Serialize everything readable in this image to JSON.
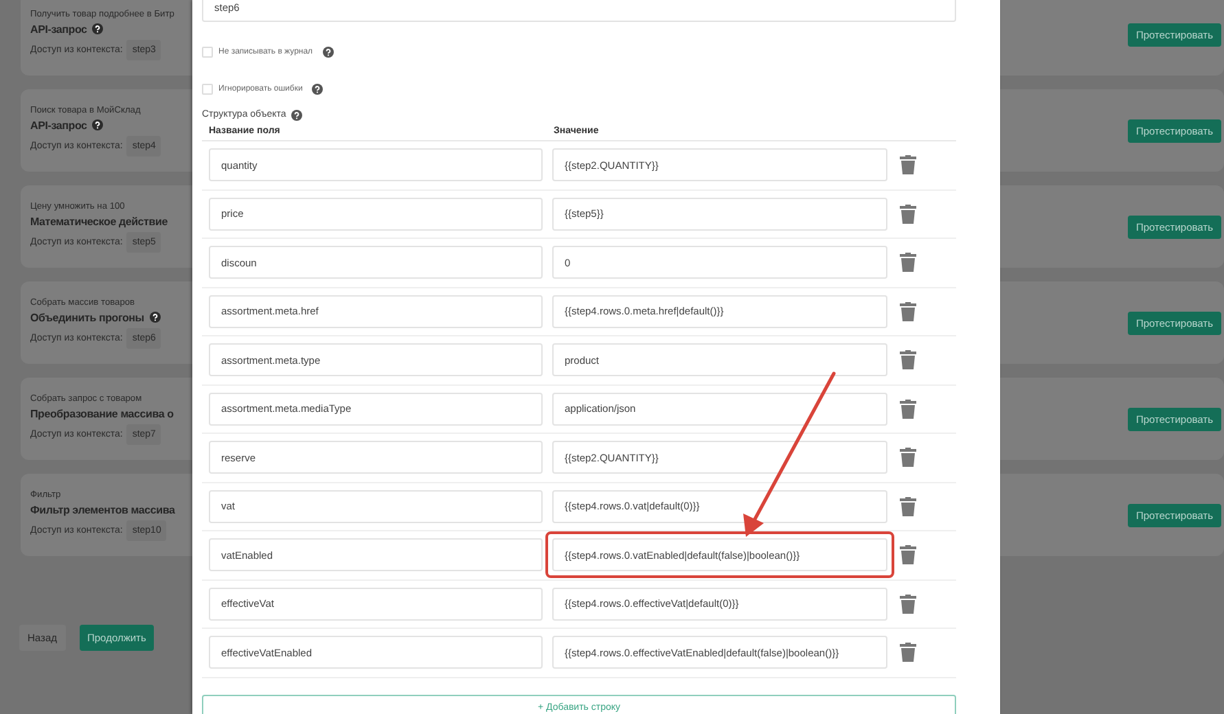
{
  "background_steps": [
    {
      "subtitle": "Получить товар подробнее в Битр",
      "title": "API-запрос",
      "help": true,
      "context_label": "Доступ из контекста:",
      "context_value": "step3",
      "button": "Протестировать"
    },
    {
      "subtitle": "Поиск товара в МойСклад",
      "title": "API-запрос",
      "help": true,
      "context_label": "Доступ из контекста:",
      "context_value": "step4",
      "button": "Протестировать"
    },
    {
      "subtitle": "Цену умножить на 100",
      "title": "Математическое действие",
      "help": false,
      "context_label": "Доступ из контекста:",
      "context_value": "step5",
      "button": "Протестировать"
    },
    {
      "subtitle": "Собрать массив товаров",
      "title": "Объединить прогоны",
      "help": true,
      "context_label": "Доступ из контекста:",
      "context_value": "step6",
      "button": "Протестировать"
    },
    {
      "subtitle": "Собрать запрос с товаром",
      "title": "Преобразование массива о",
      "help": false,
      "context_label": "Доступ из контекста:",
      "context_value": "step7",
      "button": "Протестировать"
    },
    {
      "subtitle": "Фильтр",
      "title": "Фильтр элементов массива",
      "help": false,
      "context_label": "Доступ из контекста:",
      "context_value": "step10",
      "button": "Протестировать"
    }
  ],
  "footer_buttons": [
    {
      "label": "Назад",
      "kind": "secondary"
    },
    {
      "label": "Продолжить",
      "kind": "primary"
    }
  ],
  "dialog": {
    "step_name": "step6",
    "options": [
      {
        "label": "Не записывать в журнал",
        "checked": false
      },
      {
        "label": "Игнорировать ошибки",
        "checked": false
      }
    ],
    "structure_label": "Структура объекта",
    "columns": [
      "Название поля",
      "Значение"
    ],
    "rows": [
      {
        "name": "quantity",
        "value": "{{step2.QUANTITY}}",
        "highlighted": false
      },
      {
        "name": "price",
        "value": "{{step5}}",
        "highlighted": false
      },
      {
        "name": "discoun",
        "value": "0",
        "highlighted": false
      },
      {
        "name": "assortment.meta.href",
        "value": "{{step4.rows.0.meta.href|default()}}",
        "highlighted": false
      },
      {
        "name": "assortment.meta.type",
        "value": "product",
        "highlighted": false
      },
      {
        "name": "assortment.meta.mediaType",
        "value": "application/json",
        "highlighted": false
      },
      {
        "name": "reserve",
        "value": "{{step2.QUANTITY}}",
        "highlighted": false
      },
      {
        "name": "vat",
        "value": "{{step4.rows.0.vat|default(0)}}",
        "highlighted": false
      },
      {
        "name": "vatEnabled",
        "value": "{{step4.rows.0.vatEnabled|default(false)|boolean()}}",
        "highlighted": true
      },
      {
        "name": "effectiveVat",
        "value": "{{step4.rows.0.effectiveVat|default(0)}}",
        "highlighted": false
      },
      {
        "name": "effectiveVatEnabled",
        "value": "{{step4.rows.0.effectiveVatEnabled|default(false)|boolean()}}",
        "highlighted": false
      }
    ],
    "add_row_button": "+ Добавить строку"
  }
}
